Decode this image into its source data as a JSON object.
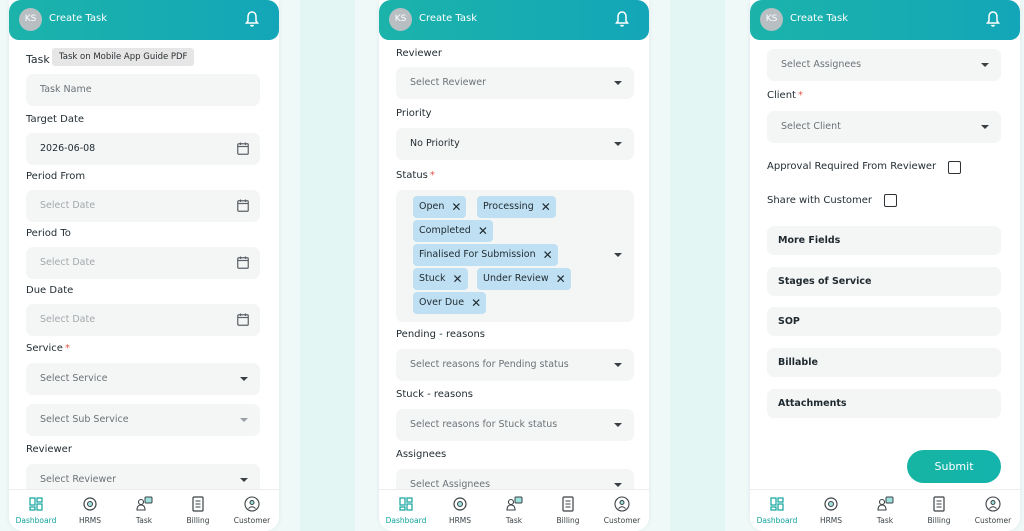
{
  "screens": [
    {
      "header": {
        "avatar": "KS",
        "title": "Create Task"
      },
      "tooltip": "Task on Mobile App Guide PDF",
      "task_label": "Task",
      "task_placeholder": "Task Name",
      "target_date_label": "Target Date",
      "target_date_value": "2026-06-08",
      "period_from_label": "Period From",
      "period_from_placeholder": "Select Date",
      "period_to_label": "Period To",
      "period_to_placeholder": "Select Date",
      "due_date_label": "Due Date",
      "due_date_placeholder": "Select Date",
      "service_label": "Service",
      "service_placeholder": "Select Service",
      "sub_service_placeholder": "Select Sub Service",
      "reviewer_label": "Reviewer",
      "reviewer_placeholder": "Select Reviewer"
    },
    {
      "header": {
        "avatar": "KS",
        "title": "Create Task"
      },
      "reviewer_label": "Reviewer",
      "reviewer_placeholder": "Select Reviewer",
      "priority_label": "Priority",
      "priority_value": "No Priority",
      "status_label": "Status",
      "status_chips": [
        "Open",
        "Processing",
        "Completed",
        "Finalised For Submission",
        "Stuck",
        "Under Review",
        "Over Due"
      ],
      "pending_label": "Pending - reasons",
      "pending_placeholder": "Select reasons for Pending status",
      "stuck_label": "Stuck - reasons",
      "stuck_placeholder": "Select reasons for Stuck status",
      "assignees_label": "Assignees",
      "assignees_placeholder": "Select Assignees"
    },
    {
      "header": {
        "avatar": "KS",
        "title": "Create Task"
      },
      "assignees_placeholder": "Select Assignees",
      "client_label": "Client",
      "client_placeholder": "Select Client",
      "approval_label": "Approval Required From Reviewer",
      "share_label": "Share with Customer",
      "sections": [
        "More Fields",
        "Stages of Service",
        "SOP",
        "Billable",
        "Attachments"
      ],
      "submit_label": "Submit"
    }
  ],
  "required_mark": "*",
  "remove_glyph": "✕",
  "nav": [
    "Dashboard",
    "HRMS",
    "Task",
    "Billing",
    "Customer"
  ],
  "colors": {
    "accent": "#13a6b8",
    "teal": "#1bb3aa",
    "chip": "#bfe0f3",
    "required": "#e0564b"
  }
}
